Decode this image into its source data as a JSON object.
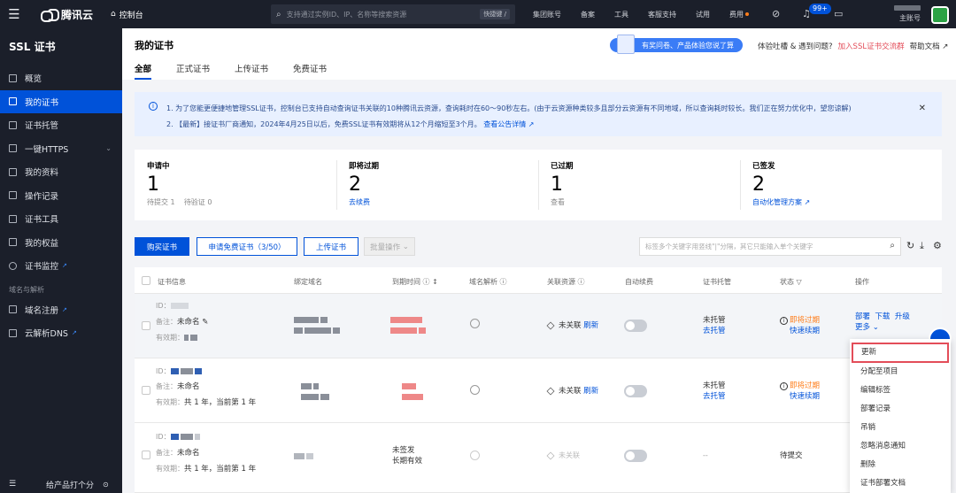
{
  "topbar": {
    "logo": "腾讯云",
    "console": "控制台",
    "search_placeholder": "支持通过实例ID、IP、名称等搜索资源",
    "shortcut": "快捷键 /",
    "nav": [
      "集团账号",
      "备案",
      "工具",
      "客服支持",
      "试用",
      "费用"
    ],
    "badge": "99+",
    "account_role": "主账号"
  },
  "sidebar": {
    "title": "SSL 证书",
    "items": [
      {
        "label": "概览"
      },
      {
        "label": "我的证书"
      },
      {
        "label": "证书托管"
      },
      {
        "label": "一键HTTPS"
      },
      {
        "label": "我的资料"
      },
      {
        "label": "操作记录"
      },
      {
        "label": "证书工具"
      },
      {
        "label": "我的权益"
      },
      {
        "label": "证书监控"
      }
    ],
    "group": "域名与解析",
    "group_items": [
      {
        "label": "域名注册"
      },
      {
        "label": "云解析DNS"
      }
    ],
    "footer": "给产品打个分"
  },
  "header": {
    "title": "我的证书",
    "tabs": [
      "全部",
      "正式证书",
      "上传证书",
      "免费证书"
    ],
    "survey": "有奖问卷、产品体验您说了算",
    "feedback": "体验吐槽 & 遇到问题?",
    "join": "加入SSL证书交流群",
    "help": "帮助文档"
  },
  "notice": {
    "line1": "1. 为了您能更便捷地管理SSL证书，控制台已支持自动查询证书关联的10种腾讯云资源，查询耗时在60～90秒左右。(由于云资源种类较多且部分云资源有不同地域，所以查询耗时较长。我们正在努力优化中，望您谅解)",
    "line2": "2. 【最新】接证书厂商通知，2024年4月25日以后，免费SSL证书有效期将从12个月缩短至3个月。",
    "line2_link": "查看公告详情"
  },
  "stats": [
    {
      "label": "申请中",
      "value": "1",
      "sub": "待提交 1",
      "sub2": "待验证 0"
    },
    {
      "label": "即将过期",
      "value": "2",
      "sub": "去续费",
      "sub2": ""
    },
    {
      "label": "已过期",
      "value": "1",
      "sub": "查看",
      "sub2": ""
    },
    {
      "label": "已签发",
      "value": "2",
      "sub": "自动化管理方案",
      "sub2": ""
    }
  ],
  "toolbar": {
    "buy": "购买证书",
    "apply_free": "申请免费证书（3/50）",
    "upload": "上传证书",
    "batch": "批量操作",
    "tag_placeholder": "标签多个关键字用竖线\"|\"分隔，其它只能输入单个关键字"
  },
  "table": {
    "headers": [
      "证书信息",
      "绑定域名",
      "到期时间",
      "域名解析",
      "关联资源",
      "自动续费",
      "证书托管",
      "状态",
      "操作"
    ],
    "rows": [
      {
        "id_label": "ID：",
        "note_label": "备注：",
        "note": "未命名",
        "valid_label": "有效期：",
        "valid": "",
        "resource": "未关联",
        "refresh": "刷新",
        "hosting": "未托管",
        "hosting_link": "去托管",
        "status": "即将过期",
        "status_link": "快速续期",
        "actions": [
          "部署",
          "下载",
          "升级"
        ],
        "more": "更多"
      },
      {
        "id_label": "ID：",
        "note_label": "备注：",
        "note": "未命名",
        "valid_label": "有效期：",
        "valid": "共 1 年，当前第 1 年",
        "resource": "未关联",
        "refresh": "刷新",
        "hosting": "未托管",
        "hosting_link": "去托管",
        "status": "即将过期",
        "status_link": "快速续期"
      },
      {
        "id_label": "ID：",
        "note_label": "备注：",
        "note": "未命名",
        "valid_label": "有效期：",
        "valid": "共 1 年，当前第 1 年",
        "expire": "未签发",
        "expire2": "长期有效",
        "resource": "未关联",
        "hosting": "--",
        "status": "待提交"
      }
    ]
  },
  "dropdown": [
    "更新",
    "分配至项目",
    "编辑标签",
    "部署记录",
    "吊销",
    "忽略消息通知",
    "删除",
    "证书部署文档"
  ],
  "colors": {
    "brand": "#0052d9",
    "warning": "#ff7d1a",
    "highlight_border": "#e34d59"
  }
}
